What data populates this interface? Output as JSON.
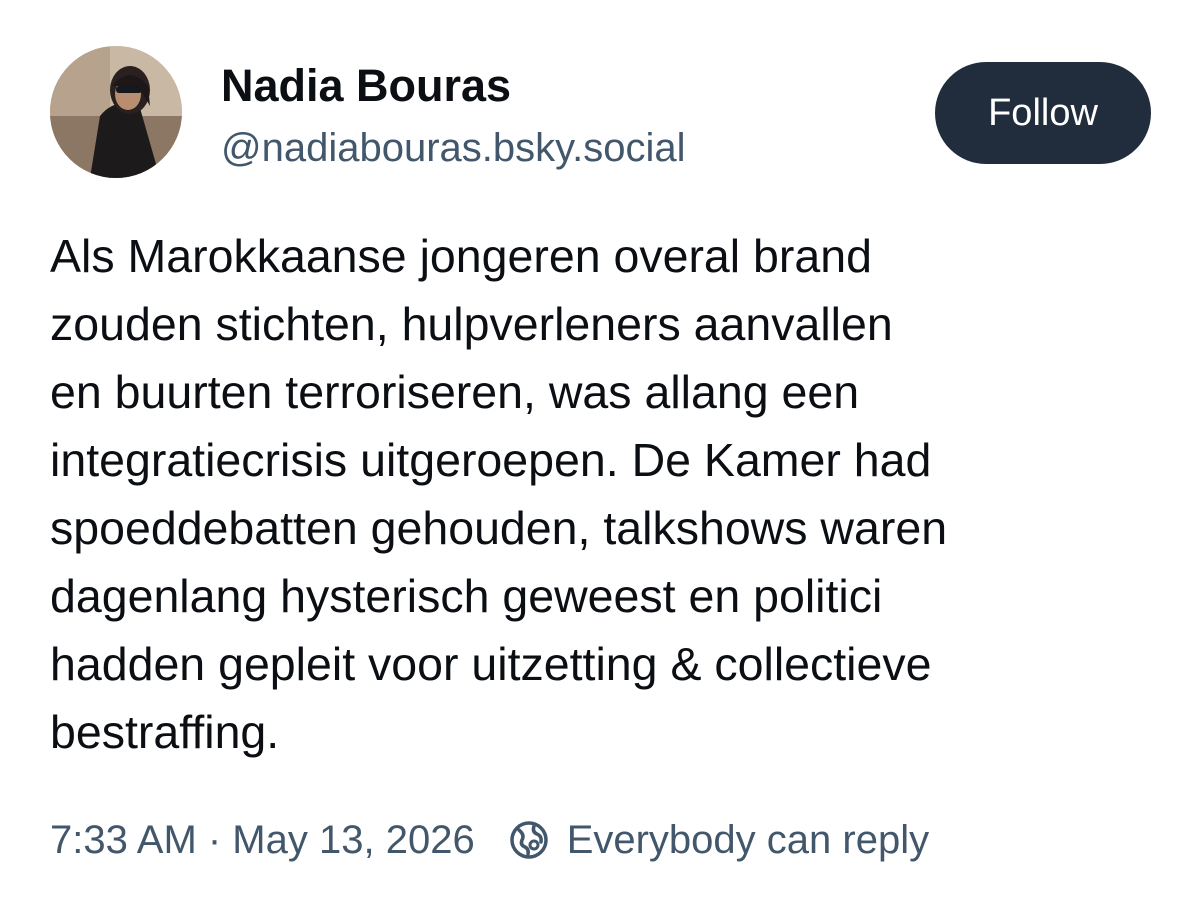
{
  "author": {
    "name": "Nadia Bouras",
    "handle": "@nadiabouras.bsky.social"
  },
  "follow_button": {
    "label": "Follow"
  },
  "post": {
    "lines": [
      "Als Marokkaanse jongeren overal brand",
      "zouden stichten, hulpverleners aanvallen",
      "en buurten terroriseren, was allang een",
      "integratiecrisis uitgeroepen. De Kamer had",
      "spoeddebatten gehouden, talkshows waren",
      "dagenlang hysterisch geweest en politici",
      "hadden gepleit voor uitzetting & collectieve",
      "bestraffing."
    ],
    "timestamp": "7:33 AM · May 13, 2026",
    "reply_setting": "Everybody can reply"
  },
  "icons": {
    "avatar": "profile-photo",
    "reply_setting": "globe-icon"
  },
  "colors": {
    "follow_button_bg": "#212d3c",
    "follow_button_text": "#ffffff",
    "name_text": "#0b0f14",
    "secondary_text": "#42576c"
  }
}
